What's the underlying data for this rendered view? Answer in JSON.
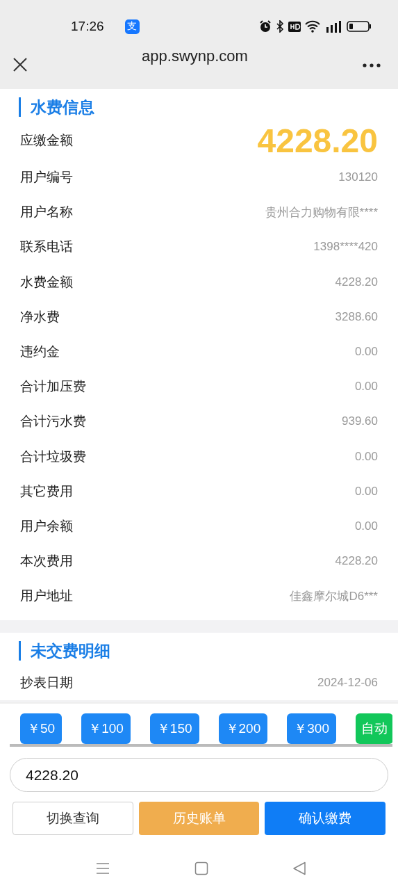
{
  "status_bar": {
    "time": "17:26",
    "app_badge": "支"
  },
  "browser": {
    "url": "app.swynp.com"
  },
  "water_info": {
    "title": "水费信息",
    "amount_due": {
      "label": "应缴金额",
      "value": "4228.20"
    },
    "rows": [
      {
        "label": "用户编号",
        "value": "130120"
      },
      {
        "label": "用户名称",
        "value": "贵州合力购物有限****"
      },
      {
        "label": "联系电话",
        "value": "1398****420"
      },
      {
        "label": "水费金额",
        "value": "4228.20"
      },
      {
        "label": "净水费",
        "value": "3288.60"
      },
      {
        "label": "违约金",
        "value": "0.00"
      },
      {
        "label": "合计加压费",
        "value": "0.00"
      },
      {
        "label": "合计污水费",
        "value": "939.60"
      },
      {
        "label": "合计垃圾费",
        "value": "0.00"
      },
      {
        "label": "其它费用",
        "value": "0.00"
      },
      {
        "label": "用户余额",
        "value": "0.00"
      },
      {
        "label": "本次费用",
        "value": "4228.20"
      },
      {
        "label": "用户地址",
        "value": "佳鑫摩尔城D6***"
      }
    ]
  },
  "unpaid": {
    "title": "未交费明细",
    "rows": [
      {
        "label": "抄表日期",
        "value": "2024-12-06"
      }
    ]
  },
  "quick_amounts": [
    {
      "label": "￥50",
      "kind": "amount"
    },
    {
      "label": "￥100",
      "kind": "amount"
    },
    {
      "label": "￥150",
      "kind": "amount"
    },
    {
      "label": "￥200",
      "kind": "amount"
    },
    {
      "label": "￥300",
      "kind": "amount"
    },
    {
      "label": "自动",
      "kind": "auto"
    }
  ],
  "amount_input": {
    "value": "4228.20"
  },
  "buttons": [
    {
      "label": "切换查询",
      "kind": "outline"
    },
    {
      "label": "历史账单",
      "kind": "warning"
    },
    {
      "label": "确认缴费",
      "kind": "primary"
    }
  ]
}
